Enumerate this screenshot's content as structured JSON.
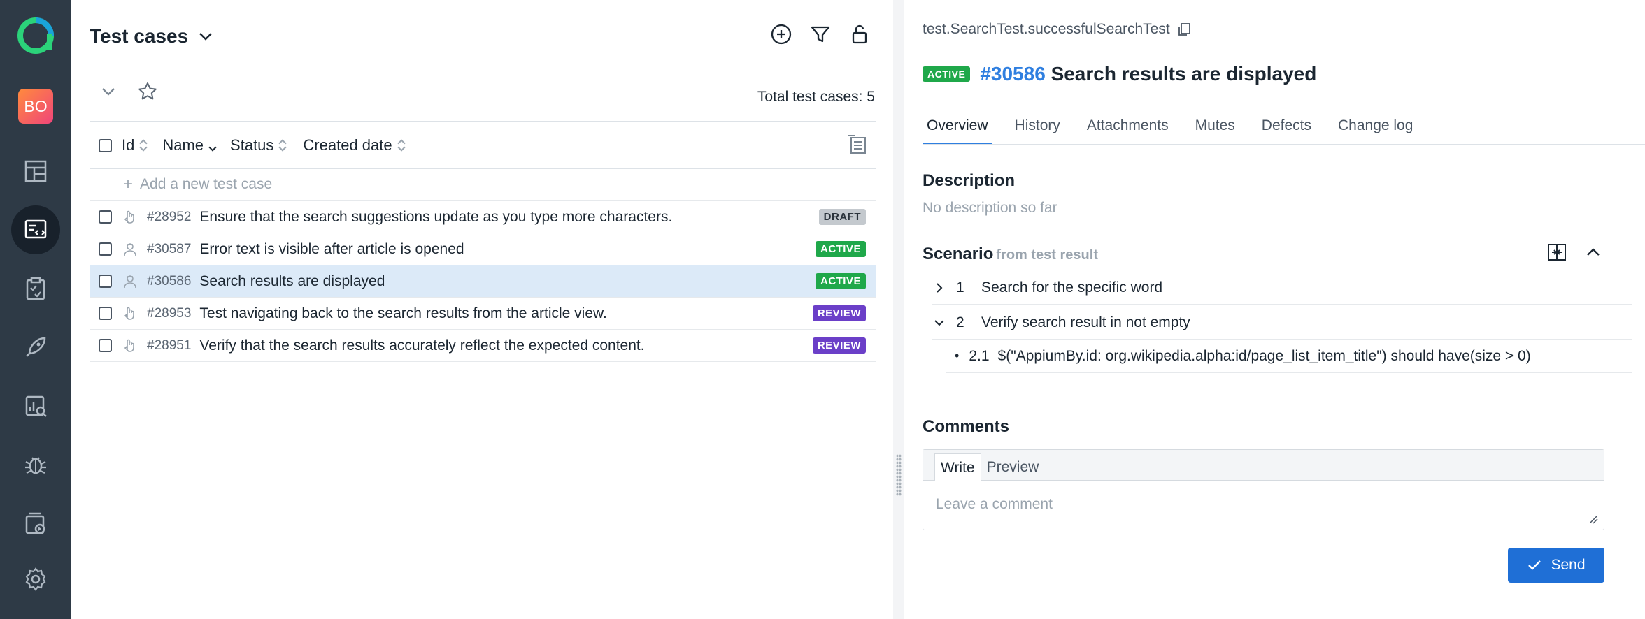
{
  "sidebar": {
    "avatar_initials": "BO",
    "items": [
      {
        "icon": "dashboard-icon"
      },
      {
        "icon": "test-cases-icon",
        "active": true
      },
      {
        "icon": "test-plans-icon"
      },
      {
        "icon": "launches-icon"
      },
      {
        "icon": "analytics-icon"
      },
      {
        "icon": "defects-icon"
      },
      {
        "icon": "jobs-icon"
      },
      {
        "icon": "settings-icon"
      }
    ]
  },
  "list": {
    "title": "Test cases",
    "total_label": "Total test cases: 5",
    "columns": {
      "id": "Id",
      "name": "Name",
      "status": "Status",
      "created": "Created date"
    },
    "add_placeholder": "Add a new test case",
    "rows": [
      {
        "id": "#28952",
        "name": "Ensure that the search suggestions update as you type more characters.",
        "status": "DRAFT",
        "type": "manual"
      },
      {
        "id": "#30587",
        "name": "Error text is visible after article is opened",
        "status": "ACTIVE",
        "type": "automated"
      },
      {
        "id": "#30586",
        "name": "Search results are displayed",
        "status": "ACTIVE",
        "type": "automated",
        "selected": true
      },
      {
        "id": "#28953",
        "name": "Test navigating back to the search results from the article view.",
        "status": "REVIEW",
        "type": "manual"
      },
      {
        "id": "#28951",
        "name": "Verify that the search results accurately reflect the expected content.",
        "status": "REVIEW",
        "type": "manual"
      }
    ]
  },
  "detail": {
    "full_name": "test.SearchTest.successfulSearchTest",
    "status": "ACTIVE",
    "id": "#30586",
    "name": "Search results are displayed",
    "tabs": [
      "Overview",
      "History",
      "Attachments",
      "Mutes",
      "Defects",
      "Change log"
    ],
    "description_title": "Description",
    "description_text": "No description so far",
    "scenario_title": "Scenario",
    "scenario_source": "from test result",
    "steps": [
      {
        "num": "1",
        "text": "Search for the specific word"
      },
      {
        "num": "2",
        "text": "Verify search result in not empty"
      }
    ],
    "substep": {
      "num": "2.1",
      "text": "$(\"AppiumBy.id: org.wikipedia.alpha:id/page_list_item_title\") should have(size > 0)"
    },
    "comments_title": "Comments",
    "comment_tabs": [
      "Write",
      "Preview"
    ],
    "comment_placeholder": "Leave a comment",
    "send_label": "Send"
  },
  "colors": {
    "accent": "#2f7fe0",
    "sidebar": "#2e3a46",
    "active": "#1fa84a",
    "review": "#6b3fc8",
    "draft": "#c4c9ce"
  }
}
